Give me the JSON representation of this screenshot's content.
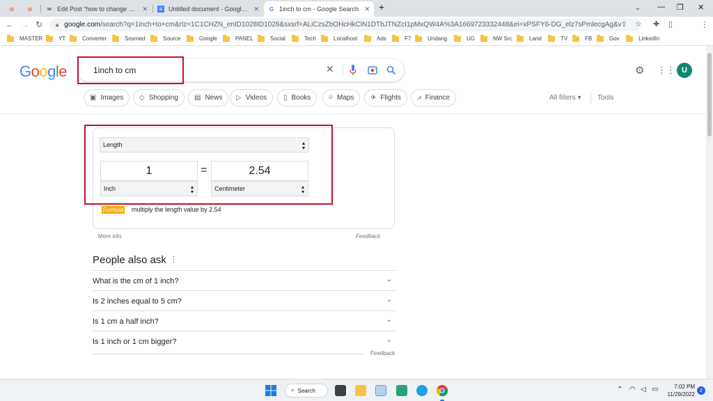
{
  "tabs": [
    {
      "title": "",
      "favicon": "orange-eye-icon"
    },
    {
      "title": "",
      "favicon": "orange-eye-icon"
    },
    {
      "title": "Edit Post “how to change margin",
      "favicon": "envelope-icon"
    },
    {
      "title": "Untitled document - Google Doc",
      "favicon": "docs-icon"
    },
    {
      "title": "1inch to cm - Google Search",
      "favicon": "google-g-icon",
      "active": true
    }
  ],
  "toolbar": {
    "url_domain": "google.com",
    "url_rest": "/search?q=1inch+to+cm&rlz=1C1CHZN_enID1028ID1028&sxsrf=ALiCzsZbOHcHkClN1DTbJTNZcI1pMxQW4A%3A1669723332448&ei=xPSFY6-DG_elz7sPmlecgAg&ved=0ahUKE..."
  },
  "bookmarks": [
    "MASTER",
    "YT",
    "Converter",
    "Sosmed",
    "Source",
    "Google",
    "PANEL",
    "Social",
    "Tech",
    "Localhost",
    "Ads",
    "F7",
    "Undang",
    "UG",
    "NW Src",
    "Land",
    "TV",
    "FB",
    "Gov",
    "LinkedIn"
  ],
  "header": {
    "logo_letters": [
      "G",
      "o",
      "o",
      "g",
      "l",
      "e"
    ],
    "logo_colors": [
      "#4285F4",
      "#EA4335",
      "#FBBC05",
      "#4285F4",
      "#34A853",
      "#EA4335"
    ],
    "query": "1inch to cm",
    "avatar": "U"
  },
  "chips": [
    "Images",
    "Shopping",
    "News",
    "Videos",
    "Books",
    "Maps",
    "Flights",
    "Finance"
  ],
  "filters": {
    "all_filters": "All filters",
    "tools": "Tools"
  },
  "converter": {
    "category": "Length",
    "from_value": "1",
    "equals": "=",
    "to_value": "2.54",
    "from_unit": "Inch",
    "to_unit": "Centimeter",
    "formula_label": "Formula",
    "formula_text": "multiply the length value by 2.54",
    "more_info": "More info",
    "feedback": "Feedback"
  },
  "paa": {
    "title": "People also ask",
    "questions": [
      "What is the cm of 1 inch?",
      "Is 2 inches equal to 5 cm?",
      "Is 1 cm a half inch?",
      "Is 1 inch or 1 cm bigger?"
    ],
    "feedback": "Feedback"
  },
  "taskbar": {
    "search": "Search",
    "time": "7:02 PM",
    "date": "11/29/2022",
    "notifications": "2"
  },
  "colors": {
    "highlight_red": "#c8102e",
    "avatar_green": "#0f8a72",
    "formula_badge": "#f9ab00"
  }
}
